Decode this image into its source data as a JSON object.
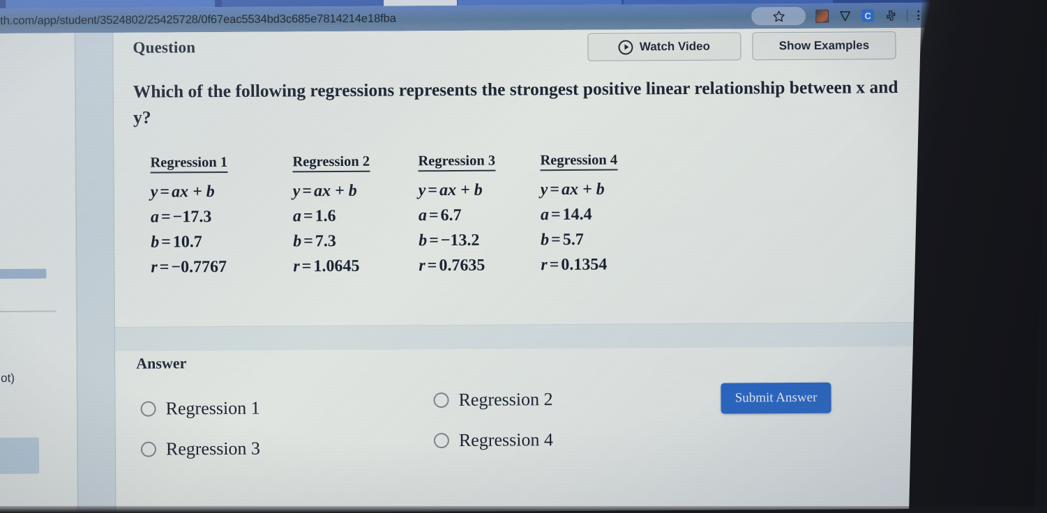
{
  "browser": {
    "url": "th.com/app/student/3524802/25425728/0f67eac5534bd3c685e7814214e18fba",
    "icons": {
      "bookmark": "star-icon",
      "extension_thumb": "extension-thumbnail-icon",
      "shield": "shield-icon",
      "c_badge": "C",
      "puzzle": "puzzle-piece-icon",
      "menu": "kebab-menu-icon"
    }
  },
  "sidebar": {
    "cut_label": "lot)"
  },
  "header": {
    "title": "Question",
    "watch_video_label": "Watch Video",
    "show_examples_label": "Show Examples"
  },
  "question": {
    "prompt": "Which of the following regressions represents the strongest positive linear relationship between x and y?",
    "regressions": [
      {
        "title": "Regression 1",
        "equation_lhs": "y",
        "equation_rhs": "ax + b",
        "a_label": "a",
        "a_value": "−17.3",
        "b_label": "b",
        "b_value": "10.7",
        "r_label": "r",
        "r_value": "−0.7767"
      },
      {
        "title": "Regression 2",
        "equation_lhs": "y",
        "equation_rhs": "ax + b",
        "a_label": "a",
        "a_value": "1.6",
        "b_label": "b",
        "b_value": "7.3",
        "r_label": "r",
        "r_value": "1.0645"
      },
      {
        "title": "Regression 3",
        "equation_lhs": "y",
        "equation_rhs": "ax + b",
        "a_label": "a",
        "a_value": "6.7",
        "b_label": "b",
        "b_value": "−13.2",
        "r_label": "r",
        "r_value": "0.7635"
      },
      {
        "title": "Regression 4",
        "equation_lhs": "y",
        "equation_rhs": "ax + b",
        "a_label": "a",
        "a_value": "14.4",
        "b_label": "b",
        "b_value": "5.7",
        "r_label": "r",
        "r_value": "0.1354"
      }
    ]
  },
  "answer": {
    "title": "Answer",
    "options": [
      {
        "label": "Regression 1",
        "selected": false
      },
      {
        "label": "Regression 2",
        "selected": false
      },
      {
        "label": "Regression 3",
        "selected": false
      },
      {
        "label": "Regression 4",
        "selected": false
      }
    ],
    "submit_label": "Submit Answer"
  },
  "colors": {
    "accent_blue": "#2565c4",
    "omnibar_blue": "#56789a",
    "tabstrip_blue": "#2b4d96",
    "page_bg": "#e6eae6",
    "text_dark": "#1b2433"
  }
}
